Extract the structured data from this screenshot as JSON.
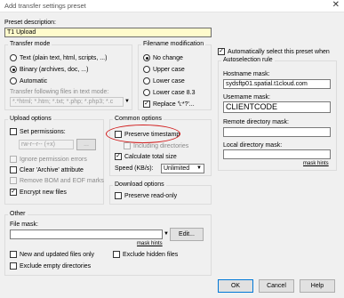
{
  "window": {
    "title": "Add transfer settings preset",
    "close_glyph": "✕"
  },
  "preset": {
    "label": "Preset description:",
    "value": "T1 Upload"
  },
  "transfer_mode": {
    "legend": "Transfer mode",
    "options": [
      "Text (plain text, html, scripts, ...)",
      "Binary (archives, doc, ...)",
      "Automatic"
    ],
    "selected": 1,
    "text_mask_label": "Transfer following files in text mode:",
    "text_mask_value": "*.*html; *.htm; *.txt; *.php; *.php3; *.c"
  },
  "filename_mod": {
    "legend": "Filename modification",
    "options": [
      "No change",
      "Upper case",
      "Lower case",
      "Lower case 8.3"
    ],
    "selected": 0,
    "replace_label": "Replace '\\:*?'...",
    "replace_checked": true
  },
  "upload_options": {
    "legend": "Upload options",
    "set_permissions": "Set permissions:",
    "permissions_value": "rw-r--r-- (+x)",
    "ignore_permission_errors": "Ignore permission errors",
    "clear_archive": "Clear 'Archive' attribute",
    "remove_bom": "Remove BOM and EOF marks",
    "encrypt_new_files": "Encrypt new files"
  },
  "common_options": {
    "legend": "Common options",
    "preserve_timestamp": "Preserve timestamp",
    "including_directories": "Including directories",
    "calculate_total_size": "Calculate total size",
    "speed_label": "Speed (KB/s):",
    "speed_value": "Unlimited"
  },
  "download_options": {
    "legend": "Download options",
    "preserve_readonly": "Preserve read-only"
  },
  "other": {
    "legend": "Other",
    "file_mask_label": "File mask:",
    "file_mask_value": "",
    "mask_hints": "mask hints",
    "edit_button": "Edit...",
    "new_updated_only": "New and updated files only",
    "exclude_hidden": "Exclude hidden files",
    "exclude_empty_dirs": "Exclude empty directories"
  },
  "autoselect": {
    "auto_select_label": "Automatically select this preset when",
    "legend": "Autoselection rule",
    "hostname_label": "Hostname mask:",
    "hostname_value": "sydsftp01.spatial.t1cloud.com",
    "username_label": "Username mask:",
    "username_value": "CLIENTCODE",
    "remote_dir_label": "Remote directory mask:",
    "remote_dir_value": "",
    "local_dir_label": "Local directory mask:",
    "local_dir_value": "",
    "mask_hints": "mask hints"
  },
  "buttons": {
    "ok": "OK",
    "cancel": "Cancel",
    "help": "Help"
  },
  "glyphs": {
    "check": "✓",
    "dropdown": "▼"
  },
  "colors": {
    "highlight_ellipse": "#d11a1a",
    "preset_field_bg": "#fffbcc",
    "focus_border": "#0078d7"
  }
}
